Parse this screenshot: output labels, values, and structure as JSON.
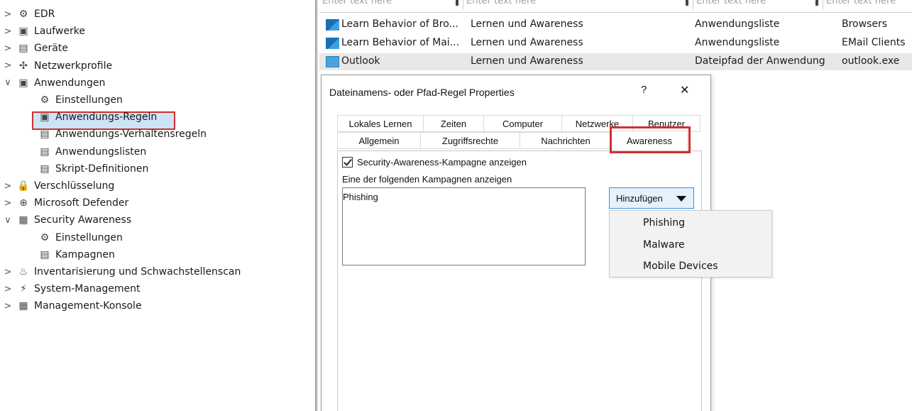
{
  "tree": {
    "items": [
      {
        "label": "EDR",
        "chev": ">",
        "icon": "network-icon",
        "glyph": "⚙",
        "indent": 0
      },
      {
        "label": "Laufwerke",
        "chev": ">",
        "icon": "drive-icon",
        "glyph": "▣",
        "indent": 0
      },
      {
        "label": "Geräte",
        "chev": ">",
        "icon": "device-icon",
        "glyph": "▤",
        "indent": 0
      },
      {
        "label": "Netzwerkprofile",
        "chev": ">",
        "icon": "network-profile-icon",
        "glyph": "✣",
        "indent": 0
      },
      {
        "label": "Anwendungen",
        "chev": "∨",
        "icon": "applications-icon",
        "glyph": "▣",
        "indent": 0
      },
      {
        "label": "Einstellungen",
        "chev": "",
        "icon": "settings-gear-icon",
        "glyph": "⚙",
        "indent": 1
      },
      {
        "label": "Anwendungs-Regeln",
        "chev": "",
        "icon": "app-rules-icon",
        "glyph": "▣",
        "indent": 1,
        "selected": true
      },
      {
        "label": "Anwendungs-Verhaltensregeln",
        "chev": "",
        "icon": "behavior-rules-icon",
        "glyph": "▤",
        "indent": 1
      },
      {
        "label": "Anwendungslisten",
        "chev": "",
        "icon": "app-lists-icon",
        "glyph": "▤",
        "indent": 1
      },
      {
        "label": "Skript-Definitionen",
        "chev": "",
        "icon": "script-definitions-icon",
        "glyph": "▤",
        "indent": 1
      },
      {
        "label": "Verschlüsselung",
        "chev": ">",
        "icon": "lock-icon",
        "glyph": "🔒",
        "indent": 0
      },
      {
        "label": "Microsoft Defender",
        "chev": ">",
        "icon": "shield-icon",
        "glyph": "⊕",
        "indent": 0
      },
      {
        "label": "Security Awareness",
        "chev": "∨",
        "icon": "security-awareness-icon",
        "glyph": "▦",
        "indent": 0
      },
      {
        "label": "Einstellungen",
        "chev": "",
        "icon": "settings-gear-icon",
        "glyph": "⚙",
        "indent": 1
      },
      {
        "label": "Kampagnen",
        "chev": "",
        "icon": "campaigns-icon",
        "glyph": "▤",
        "indent": 1
      },
      {
        "label": "Inventarisierung und Schwachstellenscan",
        "chev": ">",
        "icon": "microscope-icon",
        "glyph": "♨",
        "indent": 0
      },
      {
        "label": "System-Management",
        "chev": ">",
        "icon": "system-management-icon",
        "glyph": "⚡",
        "indent": 0
      },
      {
        "label": "Management-Konsole",
        "chev": ">",
        "icon": "console-icon",
        "glyph": "▦",
        "indent": 0
      }
    ]
  },
  "grid": {
    "filter_placeholder": "Enter text here",
    "rows": [
      {
        "name": "Learn Behavior of Bro...",
        "category": "Lernen und Awareness",
        "type": "Anwendungsliste",
        "value": "Browsers",
        "icon": "app"
      },
      {
        "name": "Learn Behavior of Mai...",
        "category": "Lernen und Awareness",
        "type": "Anwendungsliste",
        "value": "EMail Clients",
        "icon": "app"
      },
      {
        "name": "Outlook",
        "category": "Lernen und Awareness",
        "type": "Dateipfad der Anwendung",
        "value": "outlook.exe",
        "icon": "outlook",
        "highlight": true
      }
    ]
  },
  "dialog": {
    "title": "Dateinamens- oder Pfad-Regel Properties",
    "help": "?",
    "close": "✕",
    "tabs_row1": [
      "Lokales Lernen",
      "Zeiten",
      "Computer",
      "Netzwerke",
      "Benutzer"
    ],
    "tabs_row2": [
      "Allgemein",
      "Zugriffsrechte",
      "Nachrichten",
      "Awareness"
    ],
    "checkbox_label": "Security-Awareness-Kampagne anzeigen",
    "checkbox_checked": true,
    "list_label": "Eine der folgenden Kampagnen anzeigen",
    "list_items": [
      "Phishing"
    ],
    "add_button": "Hinzufügen",
    "dropdown_items": [
      "Phishing",
      "Malware",
      "Mobile Devices"
    ]
  },
  "colors": {
    "highlight_red": "#d0312d",
    "selection_blue": "#cde3f7",
    "button_blue": "#3a8fd8"
  }
}
